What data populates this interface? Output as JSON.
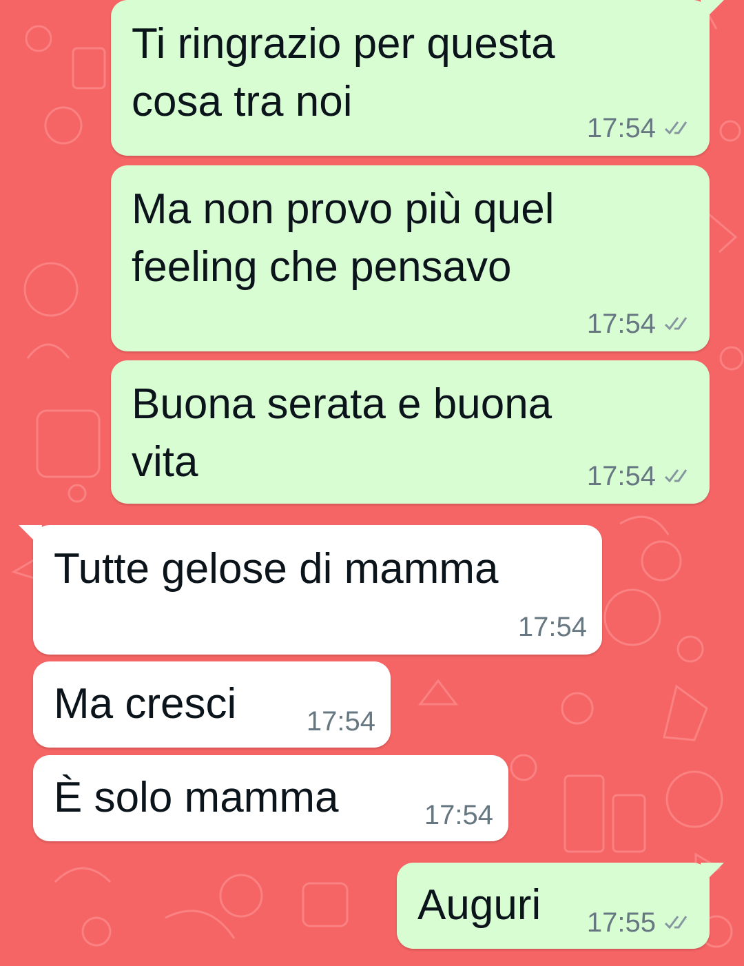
{
  "theme": {
    "background": "#f66565",
    "outgoing_bubble": "#d9fdd3",
    "incoming_bubble": "#ffffff",
    "text_color": "#0b141a",
    "meta_color": "#667781",
    "read_receipt_icon": "double-check-icon"
  },
  "messages": [
    {
      "direction": "outgoing",
      "lines": [
        "Ti ringrazio per questa",
        "cosa tra noi"
      ],
      "time": "17:54",
      "status": "read"
    },
    {
      "direction": "outgoing",
      "lines": [
        "Ma non provo più quel",
        "feeling che pensavo"
      ],
      "time": "17:54",
      "status": "read"
    },
    {
      "direction": "outgoing",
      "lines": [
        "Buona serata e buona",
        "vita"
      ],
      "time": "17:54",
      "status": "read"
    },
    {
      "direction": "incoming",
      "lines": [
        "Tutte gelose di mamma"
      ],
      "time": "17:54"
    },
    {
      "direction": "incoming",
      "lines": [
        "Ma cresci"
      ],
      "time": "17:54"
    },
    {
      "direction": "incoming",
      "lines": [
        "È solo mamma"
      ],
      "time": "17:54"
    },
    {
      "direction": "outgoing",
      "lines": [
        "Auguri"
      ],
      "time": "17:55",
      "status": "read"
    }
  ]
}
